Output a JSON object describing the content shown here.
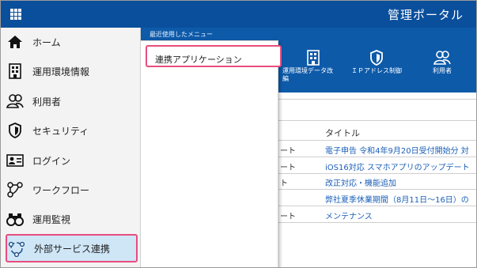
{
  "header": {
    "title": "管理ポータル",
    "menu_icon": "app-grid-icon",
    "bar_color": "#0a4f9c"
  },
  "sidebar": {
    "items": [
      {
        "label": "ホーム",
        "icon": "home-icon"
      },
      {
        "label": "運用環境情報",
        "icon": "building-icon"
      },
      {
        "label": "利用者",
        "icon": "users-icon"
      },
      {
        "label": "セキュリティ",
        "icon": "shield-icon"
      },
      {
        "label": "ログイン",
        "icon": "id-card-icon"
      },
      {
        "label": "ワークフロー",
        "icon": "workflow-icon"
      },
      {
        "label": "運用監視",
        "icon": "binoculars-icon"
      },
      {
        "label": "外部サービス連携",
        "icon": "external-link-icon",
        "active": true
      }
    ],
    "highlight_color": "#e84d7e"
  },
  "recent_menu": {
    "caption": "最近使用したメニュー",
    "items": [
      {
        "label": "連携アプリケーション"
      }
    ]
  },
  "quick_links": [
    {
      "label": "運用環境データ改\n編",
      "icon": "building-icon"
    },
    {
      "label": "ＩＰアドレス制御",
      "icon": "shield-icon"
    },
    {
      "label": "利用者",
      "icon": "users-icon"
    }
  ],
  "notices": {
    "column_header": "タイトル",
    "rows": [
      {
        "category": "ート",
        "title": "電子申告 令和4年9月20日受付開始分 対"
      },
      {
        "category": "ート",
        "title": "iOS16対応 スマホアプリのアップデート"
      },
      {
        "category": "ト",
        "title": "改正対応・機能追加"
      },
      {
        "category": "",
        "title": "弊社夏季休業期間（8月11日～16日）の"
      },
      {
        "category": "ート",
        "title": "メンテナンス"
      }
    ]
  }
}
